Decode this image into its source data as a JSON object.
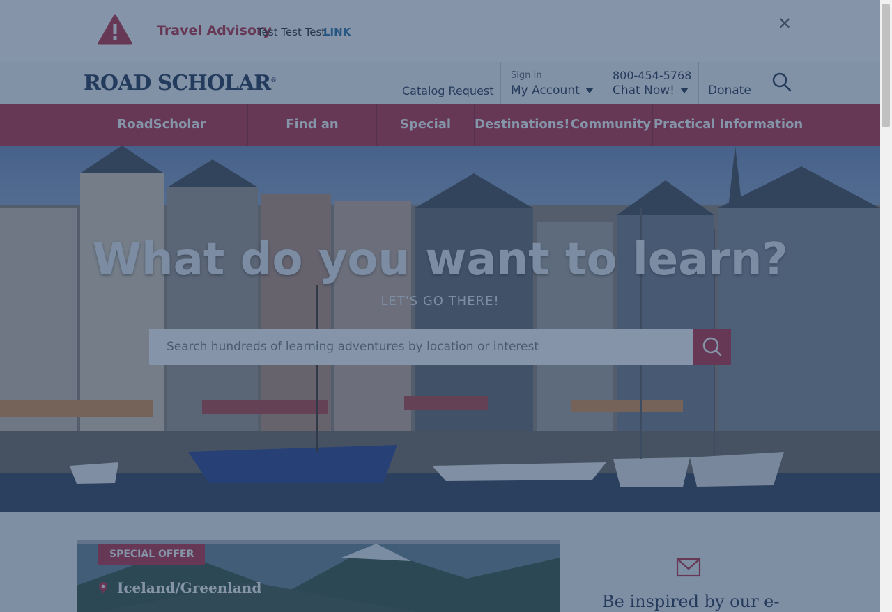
{
  "advisory": {
    "title": "Travel Advisory",
    "text": "Test Test Test",
    "link": "LINK",
    "close_icon": "close-icon",
    "warning_icon": "warning-icon"
  },
  "header": {
    "logo": "ROAD SCHOLAR",
    "logo_mark": "®",
    "catalog_request": "Catalog Request",
    "sign_in": "Sign In",
    "my_account": "My Account",
    "phone": "800-454-5768",
    "chat_now": "Chat Now!",
    "donate": "Donate",
    "search_icon": "search-icon"
  },
  "nav": {
    "items": [
      "RoadScholar Experience",
      "Find an Adventure",
      "Special Offers",
      "Destinations!",
      "Community",
      "Practical Information"
    ]
  },
  "hero": {
    "title": "What do you want to learn?",
    "subtitle": "LET'S GO THERE!",
    "search_placeholder": "Search hundreds of learning adventures by location or interest"
  },
  "card": {
    "badge": "SPECIAL OFFER",
    "location": "Iceland/Greenland"
  },
  "newsletter": {
    "heading": "Be inspired by our e-"
  },
  "colors": {
    "brand_red": "#b5243a",
    "navy": "#162b4e",
    "link_blue": "#1d6fa8"
  }
}
